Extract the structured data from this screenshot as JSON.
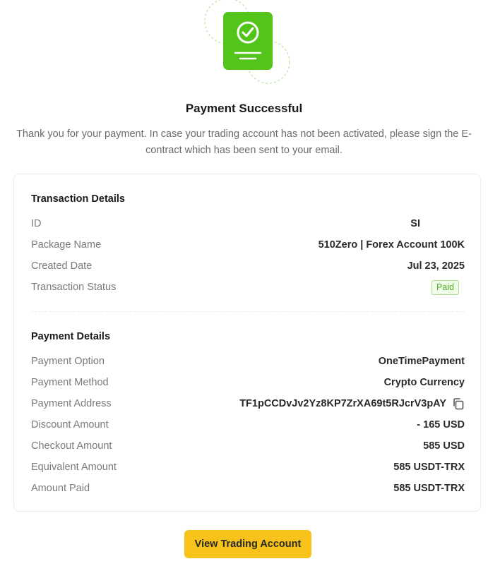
{
  "hero": {
    "icon": "payment-document-check-icon",
    "accent_color": "#52c41a"
  },
  "title": "Payment Successful",
  "subtitle": "Thank you for your payment. In case your trading account has not been activated, please sign the E-contract which has been sent to your email.",
  "transaction": {
    "heading": "Transaction Details",
    "id_label": "ID",
    "id_value": "SI",
    "package_label": "Package Name",
    "package_value": "510Zero | Forex Account 100K",
    "created_label": "Created Date",
    "created_value": "Jul 23, 2025",
    "status_label": "Transaction Status",
    "status_value": "Paid",
    "status_color": "#4caf2a"
  },
  "payment": {
    "heading": "Payment Details",
    "option_label": "Payment Option",
    "option_value": "OneTimePayment",
    "method_label": "Payment Method",
    "method_value": "Crypto Currency",
    "address_label": "Payment Address",
    "address_value": "TF1pCCDvJv2Yz8KP7ZrXA69t5RJcrV3pAY",
    "address_icon": "copy-icon",
    "discount_label": "Discount Amount",
    "discount_value": "- 165 USD",
    "checkout_label": "Checkout Amount",
    "checkout_value": "585 USD",
    "equivalent_label": "Equivalent Amount",
    "equivalent_value": "585 USDT-TRX",
    "paid_label": "Amount Paid",
    "paid_value": "585 USDT-TRX"
  },
  "cta": {
    "label": "View Trading Account",
    "color": "#f7c31b"
  }
}
